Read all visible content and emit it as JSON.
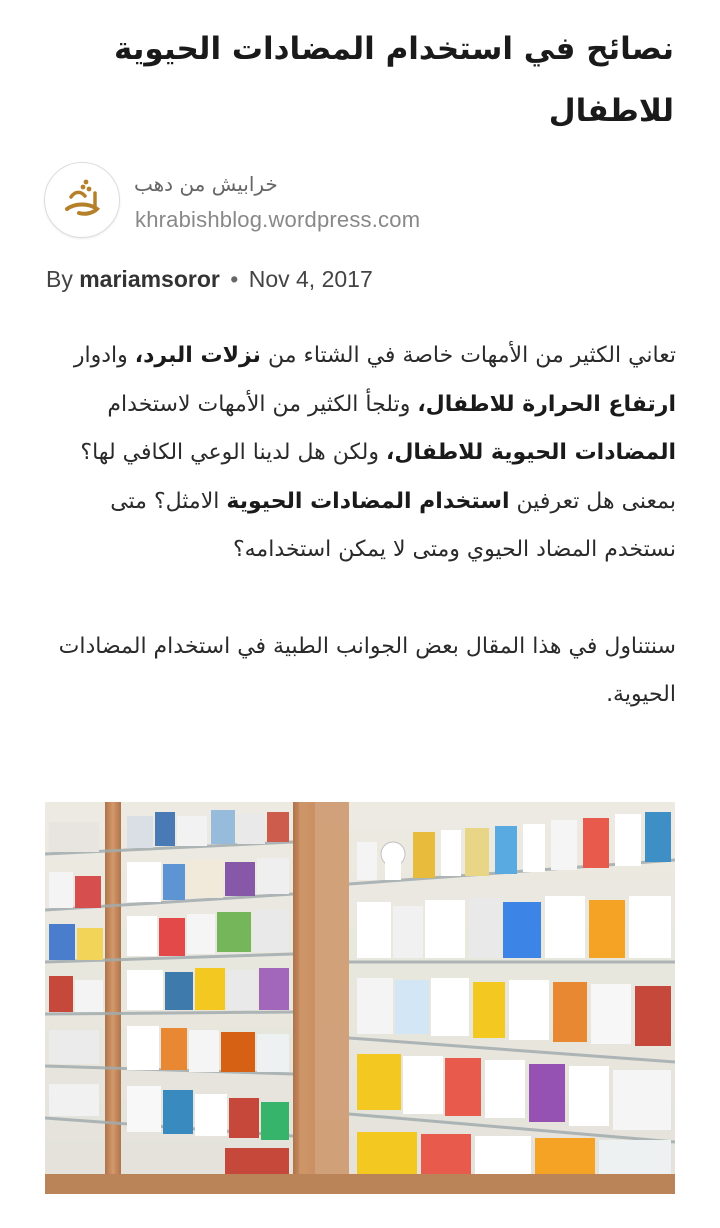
{
  "article": {
    "title": "نصائح في استخدام المضادات الحيوية للاطفال",
    "source_name": "خرابيش من دهب",
    "source_domain": "khrabishblog.wordpress.com",
    "by_label": "By",
    "author": "mariamsoror",
    "separator": "•",
    "date": "Nov 4, 2017",
    "p1": {
      "s1": "تعاني الكثير من الأمهات خاصة في الشتاء من ",
      "b1": "نزلات البرد،",
      "s2": " وادوار ",
      "b2": "ارتفاع الحرارة للاطفال،",
      "s3": "  وتلجأ الكثير من الأمهات لاستخدام ",
      "b3": "المضادات الحيوية للاطفال،",
      "s4": "  ولكن هل لدينا الوعي الكافي لها؟ بمعنى هل تعرفين ",
      "b4": "استخدام المضادات الحيوية",
      "s5": " الامثل؟ متى نستخدم المضاد الحيوي ومتى لا يمكن استخدامه؟"
    },
    "p2": "سنتناول في هذا المقال بعض الجوانب الطبية في استخدام المضادات الحيوية."
  },
  "image": {
    "description_icon": "pharmacy-shelves-photo"
  },
  "colors": {
    "shelf_wood": "#c8874e",
    "shelf_glass": "#e9eef0",
    "background": "#ffffff"
  }
}
